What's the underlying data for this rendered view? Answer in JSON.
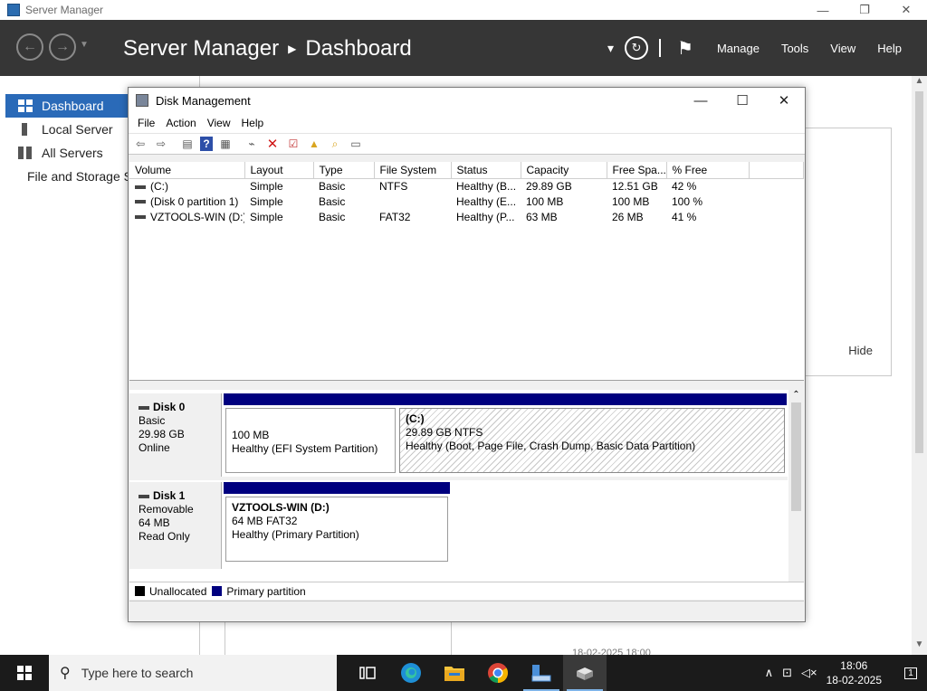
{
  "server_manager": {
    "window_title": "Server Manager",
    "controls": {
      "minimize": "—",
      "restore": "❐",
      "close": "✕"
    },
    "breadcrumb": {
      "app": "Server Manager",
      "separator": "▶",
      "page": "Dashboard"
    },
    "menu": [
      "Manage",
      "Tools",
      "View",
      "Help"
    ],
    "sidebar": [
      {
        "label": "Dashboard",
        "icon": "grid-icon",
        "active": true
      },
      {
        "label": "Local Server",
        "icon": "server-icon",
        "active": false
      },
      {
        "label": "All Servers",
        "icon": "servers-icon",
        "active": false
      },
      {
        "label": "File and Storage Services",
        "icon": "storage-icon",
        "active": false
      }
    ],
    "tile_hide_label": "Hide",
    "background_timestamp": "18-02-2025 18:00"
  },
  "disk_management": {
    "title": "Disk Management",
    "controls": {
      "minimize": "—",
      "maximize": "☐",
      "close": "✕"
    },
    "menu": [
      "File",
      "Action",
      "View",
      "Help"
    ],
    "toolbar": [
      "back-icon",
      "forward-icon",
      "view-icon",
      "help-icon",
      "properties-icon",
      "connect-icon",
      "delete-icon",
      "check-icon",
      "up-folder-icon",
      "search-folder-icon",
      "settings-icon"
    ],
    "columns": [
      "Volume",
      "Layout",
      "Type",
      "File System",
      "Status",
      "Capacity",
      "Free Spa...",
      "% Free"
    ],
    "volumes": [
      {
        "volume": "(C:)",
        "layout": "Simple",
        "type": "Basic",
        "fs": "NTFS",
        "status": "Healthy (B...",
        "capacity": "29.89 GB",
        "free": "12.51 GB",
        "pct": "42 %"
      },
      {
        "volume": "(Disk 0 partition 1)",
        "layout": "Simple",
        "type": "Basic",
        "fs": "",
        "status": "Healthy (E...",
        "capacity": "100 MB",
        "free": "100 MB",
        "pct": "100 %"
      },
      {
        "volume": "VZTOOLS-WIN (D:)",
        "layout": "Simple",
        "type": "Basic",
        "fs": "FAT32",
        "status": "Healthy (P...",
        "capacity": "63 MB",
        "free": "26 MB",
        "pct": "41 %"
      }
    ],
    "disks": [
      {
        "name": "Disk 0",
        "type": "Basic",
        "size": "29.98 GB",
        "state": "Online",
        "partitions": [
          {
            "name": "",
            "size": "100 MB",
            "status": "Healthy (EFI System Partition)"
          },
          {
            "name": "(C:)",
            "size": "29.89 GB NTFS",
            "status": "Healthy (Boot, Page File, Crash Dump, Basic Data Partition)"
          }
        ]
      },
      {
        "name": "Disk 1",
        "type": "Removable",
        "size": "64 MB",
        "state": "Read Only",
        "partitions": [
          {
            "name": "VZTOOLS-WIN  (D:)",
            "size": "64 MB FAT32",
            "status": "Healthy (Primary Partition)"
          }
        ]
      }
    ],
    "legend": [
      {
        "label": "Unallocated",
        "color": "#000000"
      },
      {
        "label": "Primary partition",
        "color": "#00007f"
      }
    ]
  },
  "taskbar": {
    "search_placeholder": "Type here to search",
    "apps": [
      "task-view-icon",
      "edge-icon",
      "file-explorer-icon",
      "chrome-icon",
      "server-manager-icon",
      "disk-management-icon"
    ],
    "time": "18:06",
    "date": "18-02-2025",
    "notification_count": "1"
  }
}
